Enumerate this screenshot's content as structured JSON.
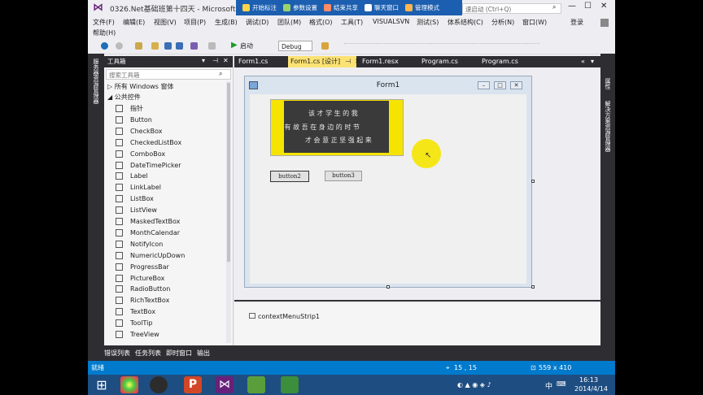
{
  "window": {
    "title": "0326.Net基础班第十四天 - Microsoft Visual Studio",
    "quick_launch_placeholder": "速启动 (Ctrl+Q)",
    "user": "登录"
  },
  "overlay_toolbar": {
    "items": [
      "开始标注",
      "参数设置",
      "结束共享",
      "聊天窗口",
      "管理模式"
    ]
  },
  "menu": {
    "items": [
      "文件(F)",
      "编辑(E)",
      "视图(V)",
      "项目(P)",
      "生成(B)",
      "调试(D)",
      "团队(M)",
      "格式(O)",
      "工具(T)",
      "VISUALSVN",
      "测试(S)",
      "体系结构(C)",
      "分析(N)",
      "窗口(W)"
    ],
    "help": "帮助(H)"
  },
  "toolbar": {
    "start_label": "启动",
    "config_value": "Debug"
  },
  "toolbox": {
    "title": "工具箱",
    "search_placeholder": "搜索工具箱",
    "category_all": "所有 Windows 窗体",
    "category_common": "公共控件",
    "items": [
      "指针",
      "Button",
      "CheckBox",
      "CheckedListBox",
      "ComboBox",
      "DateTimePicker",
      "Label",
      "LinkLabel",
      "ListBox",
      "ListView",
      "MaskedTextBox",
      "MonthCalendar",
      "NotifyIcon",
      "NumericUpDown",
      "ProgressBar",
      "PictureBox",
      "RadioButton",
      "RichTextBox",
      "TextBox",
      "ToolTip",
      "TreeView"
    ]
  },
  "side_panels": {
    "left": "服务器资源管理器",
    "right": [
      "属性",
      "解决方案资源管理器"
    ]
  },
  "tabs": [
    {
      "label": "Form1.cs",
      "active": false
    },
    {
      "label": "Form1.cs [设计]",
      "active": true
    },
    {
      "label": "Form1.resx",
      "active": false
    },
    {
      "label": "Program.cs",
      "active": false
    },
    {
      "label": "Program.cs",
      "active": false
    }
  ],
  "designer": {
    "form_title": "Form1",
    "picture_lines": [
      "该 才 学 生 的 我",
      "才 有 故 吾 在 身 边 的 时 节",
      "才 会 意 正 坚 强 起 来"
    ],
    "button2": "button2",
    "button3": "button3",
    "tray_component": "contextMenuStrip1"
  },
  "bottom_tabs": [
    "错误列表",
    "任务列表",
    "即时窗口",
    "输出"
  ],
  "status": {
    "text": "就绪",
    "position": "15 , 15",
    "size": "559 x 410"
  },
  "taskbar": {
    "time": "16:13",
    "date": "2014/4/14",
    "ime": "中"
  },
  "colors": {
    "accent": "#007acc",
    "overlay": "#1c5fb0",
    "active_tab": "#fbe273",
    "dark_chrome": "#2e2e32",
    "taskbar": "#1e4d82",
    "cursor_highlight": "#f5e400"
  }
}
